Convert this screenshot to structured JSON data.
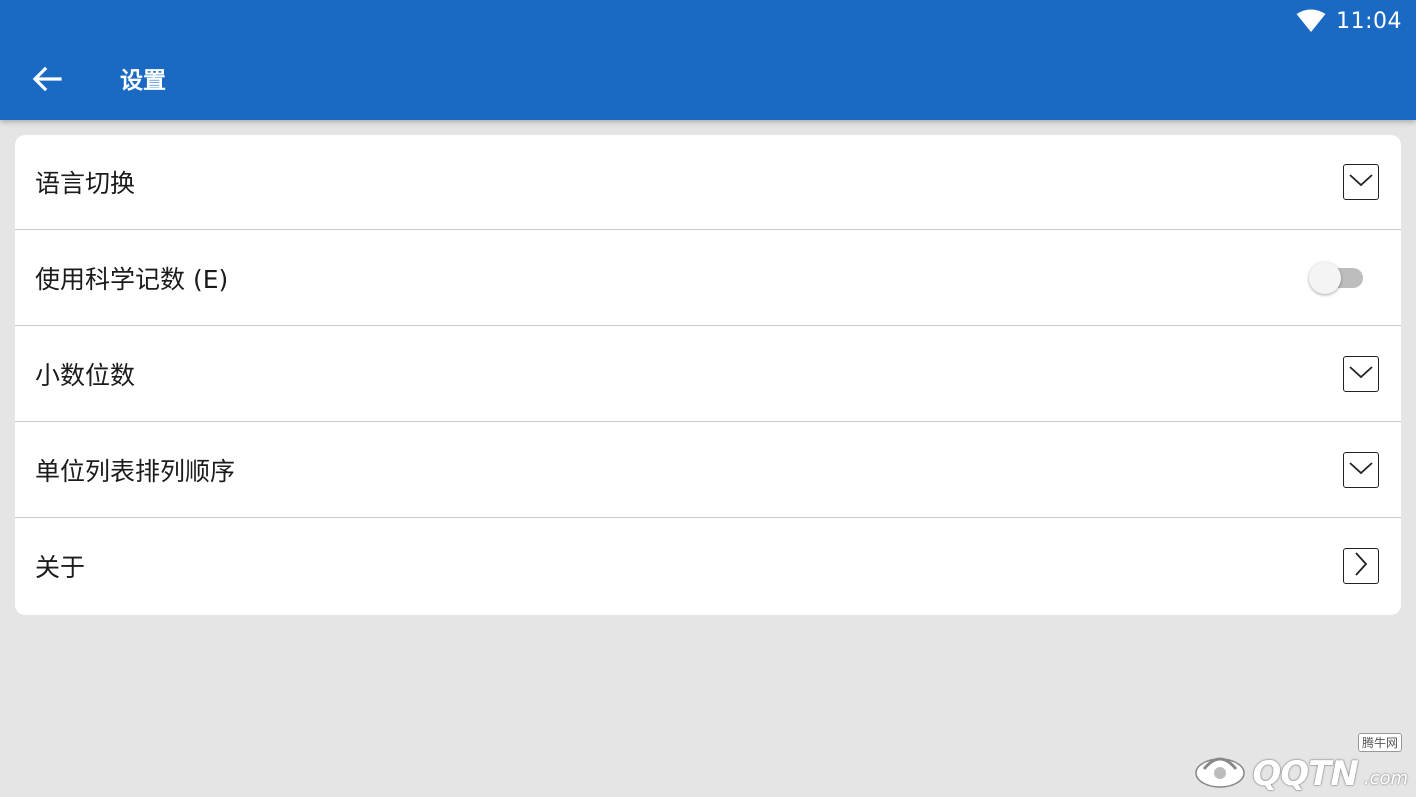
{
  "status_bar": {
    "time": "11:04",
    "wifi_icon": "wifi-icon"
  },
  "appbar": {
    "back_icon": "arrow-left-icon",
    "title": "设置",
    "color": "#1a6ac4"
  },
  "settings": {
    "language": {
      "label": "语言切换",
      "icon": "chevron-down-icon"
    },
    "scientific": {
      "label": "使用科学记数 (E)",
      "enabled": false
    },
    "decimals": {
      "label": "小数位数",
      "icon": "chevron-down-icon"
    },
    "unit_order": {
      "label": "单位列表排列顺序",
      "icon": "chevron-down-icon"
    },
    "about": {
      "label": "关于",
      "icon": "chevron-right-icon"
    }
  },
  "watermark": {
    "brand": "QQTN",
    "suffix": ".com",
    "tag": "腾牛网"
  }
}
